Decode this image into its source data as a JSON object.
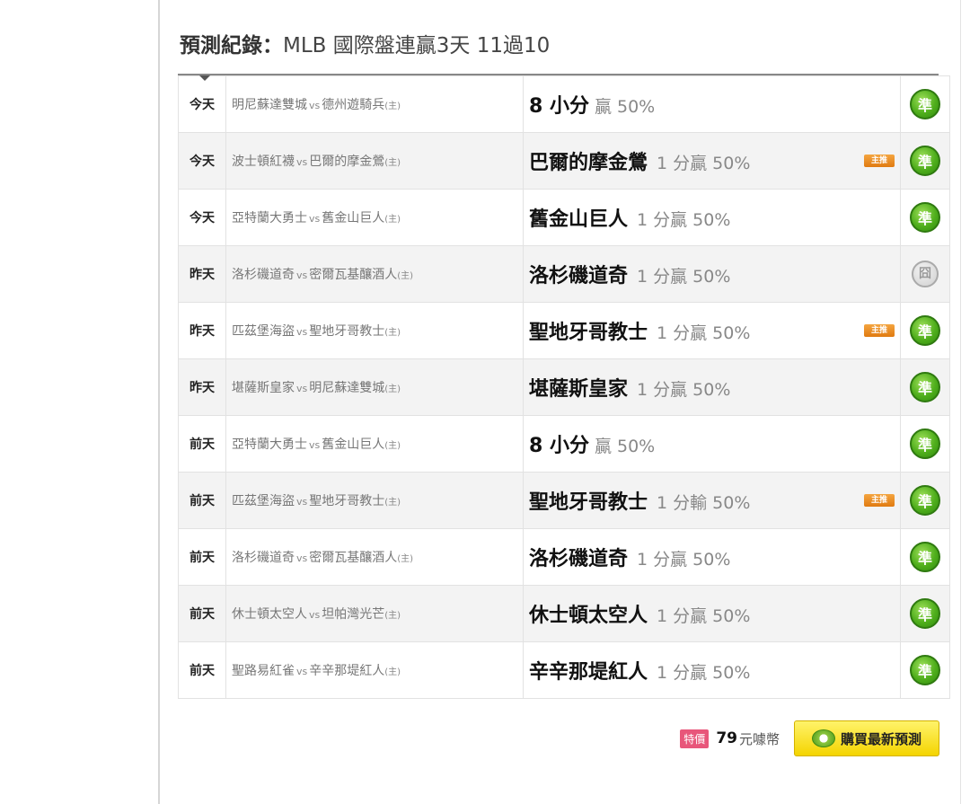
{
  "title": {
    "label": "預測紀錄：",
    "league": "MLB 國際盤連贏3天",
    "record": "11過10"
  },
  "rows": [
    {
      "day": "今天",
      "away": "明尼蘇達雙城",
      "vs": "vs",
      "home": "德州遊騎兵",
      "host": "(主)",
      "pick": "8 小分",
      "detail": "",
      "pct_label": "贏 50%",
      "master": false,
      "result": "準",
      "result_type": "win"
    },
    {
      "day": "今天",
      "away": "波士頓紅襪",
      "vs": "vs",
      "home": "巴爾的摩金鶯",
      "host": "(主)",
      "pick": "巴爾的摩金鶯",
      "detail": "1 分贏",
      "pct_label": "50%",
      "master": true,
      "result": "準",
      "result_type": "win"
    },
    {
      "day": "今天",
      "away": "亞特蘭大勇士",
      "vs": "vs",
      "home": "舊金山巨人",
      "host": "(主)",
      "pick": "舊金山巨人",
      "detail": "1 分贏",
      "pct_label": "50%",
      "master": false,
      "result": "準",
      "result_type": "win"
    },
    {
      "day": "昨天",
      "away": "洛杉磯道奇",
      "vs": "vs",
      "home": "密爾瓦基釀酒人",
      "host": "(主)",
      "pick": "洛杉磯道奇",
      "detail": "1 分贏",
      "pct_label": "50%",
      "master": false,
      "result": "囧",
      "result_type": "push"
    },
    {
      "day": "昨天",
      "away": "匹茲堡海盜",
      "vs": "vs",
      "home": "聖地牙哥教士",
      "host": "(主)",
      "pick": "聖地牙哥教士",
      "detail": "1 分贏",
      "pct_label": "50%",
      "master": true,
      "result": "準",
      "result_type": "win"
    },
    {
      "day": "昨天",
      "away": "堪薩斯皇家",
      "vs": "vs",
      "home": "明尼蘇達雙城",
      "host": "(主)",
      "pick": "堪薩斯皇家",
      "detail": "1 分贏",
      "pct_label": "50%",
      "master": false,
      "result": "準",
      "result_type": "win"
    },
    {
      "day": "前天",
      "away": "亞特蘭大勇士",
      "vs": "vs",
      "home": "舊金山巨人",
      "host": "(主)",
      "pick": "8 小分",
      "detail": "",
      "pct_label": "贏 50%",
      "master": false,
      "result": "準",
      "result_type": "win"
    },
    {
      "day": "前天",
      "away": "匹茲堡海盜",
      "vs": "vs",
      "home": "聖地牙哥教士",
      "host": "(主)",
      "pick": "聖地牙哥教士",
      "detail": "1 分輸",
      "pct_label": "50%",
      "master": true,
      "result": "準",
      "result_type": "win"
    },
    {
      "day": "前天",
      "away": "洛杉磯道奇",
      "vs": "vs",
      "home": "密爾瓦基釀酒人",
      "host": "(主)",
      "pick": "洛杉磯道奇",
      "detail": "1 分贏",
      "pct_label": "50%",
      "master": false,
      "result": "準",
      "result_type": "win"
    },
    {
      "day": "前天",
      "away": "休士頓太空人",
      "vs": "vs",
      "home": "坦帕灣光芒",
      "host": "(主)",
      "pick": "休士頓太空人",
      "detail": "1 分贏",
      "pct_label": "50%",
      "master": false,
      "result": "準",
      "result_type": "win"
    },
    {
      "day": "前天",
      "away": "聖路易紅雀",
      "vs": "vs",
      "home": "辛辛那堤紅人",
      "host": "(主)",
      "pick": "辛辛那堤紅人",
      "detail": "1 分贏",
      "pct_label": "50%",
      "master": false,
      "result": "準",
      "result_type": "win"
    }
  ],
  "master_badge": "主推",
  "footer": {
    "special_tag": "特價",
    "price": "79",
    "price_unit": "元噱幣",
    "buy_label": "購買最新預測"
  }
}
